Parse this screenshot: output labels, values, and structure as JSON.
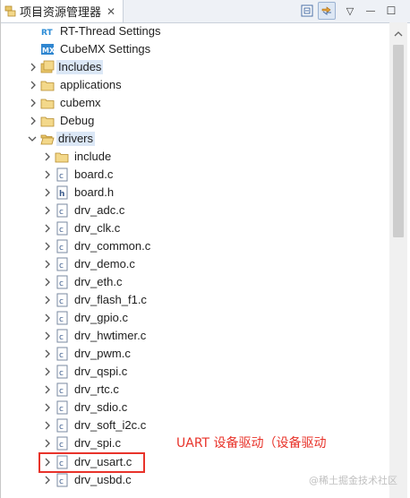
{
  "tab": {
    "title": "项目资源管理器",
    "close_glyph": "✕"
  },
  "toolbar": {
    "collapse_icon": "collapse-all-icon",
    "link_icon": "link-with-editor-icon",
    "menu_glyph": "▽",
    "min_glyph": "—",
    "max_glyph": "☐"
  },
  "tree": {
    "rtt_settings": "RT-Thread Settings",
    "cubemx_settings": "CubeMX Settings",
    "includes": "Includes",
    "applications": "applications",
    "cubemx": "cubemx",
    "debug": "Debug",
    "drivers": "drivers",
    "include": "include",
    "files": [
      "board.c",
      "board.h",
      "drv_adc.c",
      "drv_clk.c",
      "drv_common.c",
      "drv_demo.c",
      "drv_eth.c",
      "drv_flash_f1.c",
      "drv_gpio.c",
      "drv_hwtimer.c",
      "drv_pwm.c",
      "drv_qspi.c",
      "drv_rtc.c",
      "drv_sdio.c",
      "drv_soft_i2c.c",
      "drv_spi.c",
      "drv_usart.c",
      "drv_usbd.c"
    ],
    "icon_rt_text": "RT",
    "icon_mx_text": "MX",
    "icon_c_text": "c",
    "icon_h_text": "h"
  },
  "annotation": "UART 设备驱动（设备驱动",
  "watermark": "@稀土掘金技术社区",
  "colors": {
    "annotation": "#e8332a",
    "selection": "#dbe7f6",
    "folder": "#e8c66a"
  }
}
